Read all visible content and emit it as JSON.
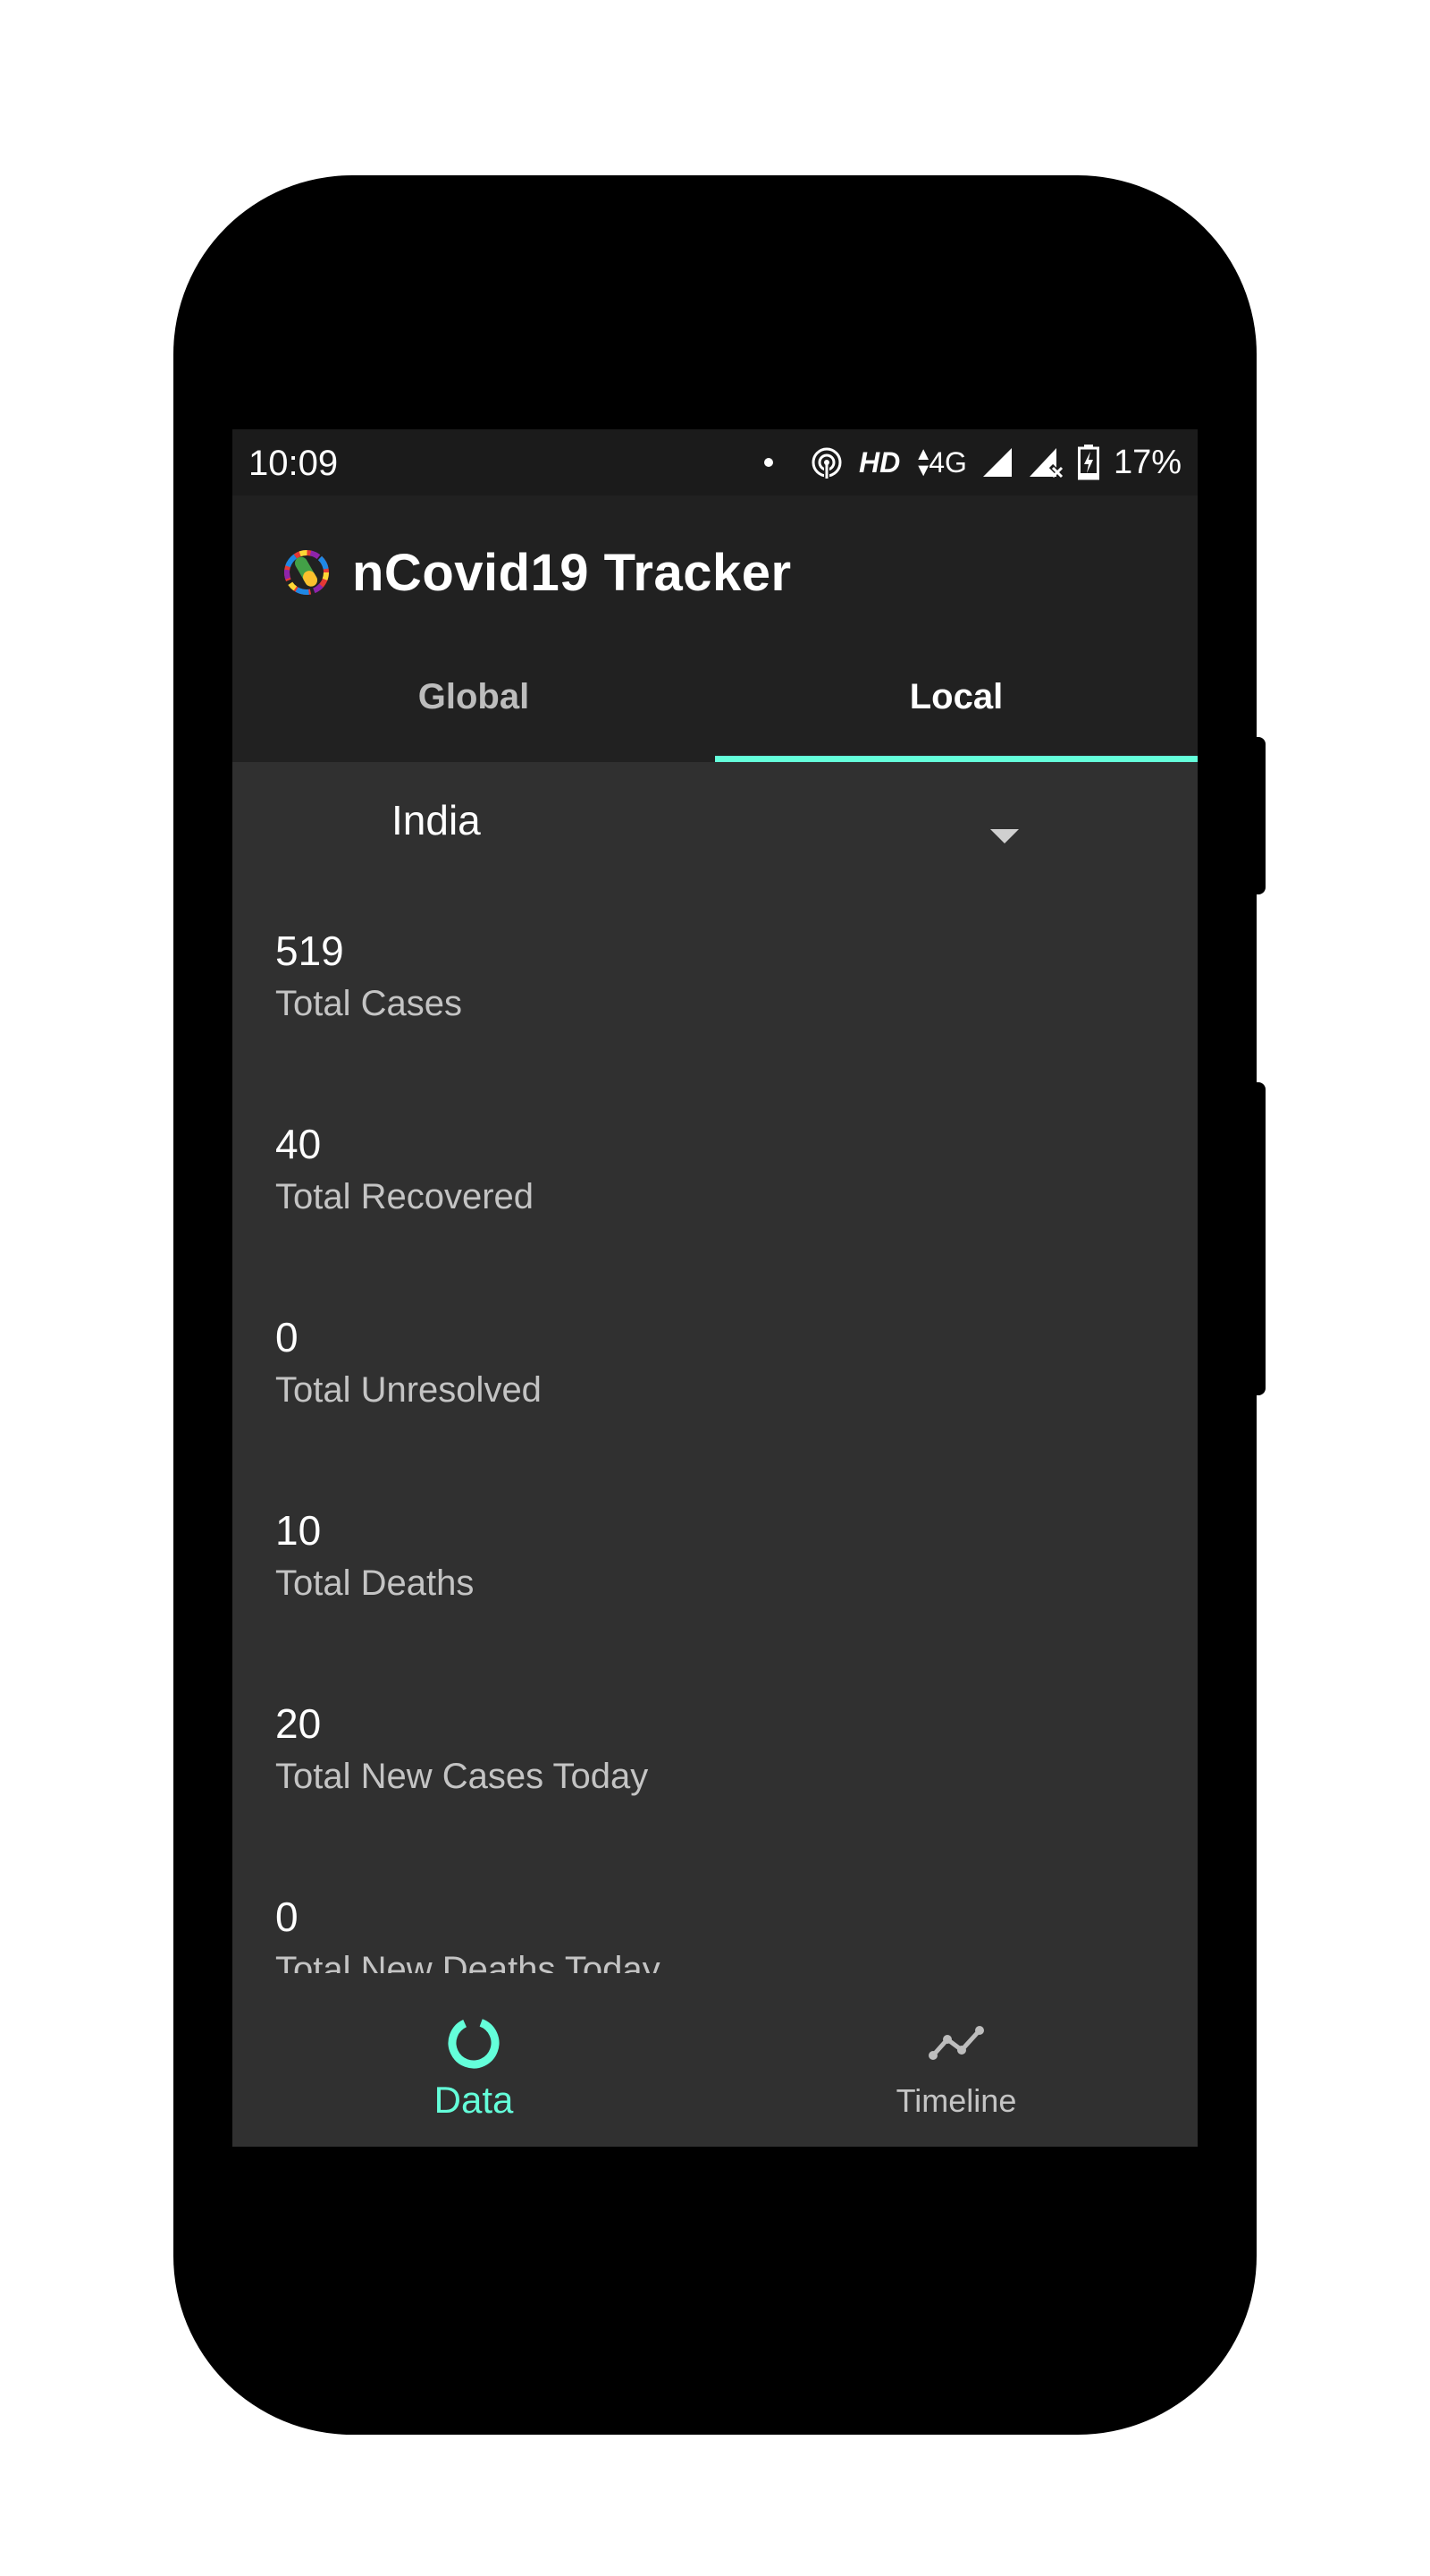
{
  "status_bar": {
    "time": "10:09",
    "network_hd": "HD",
    "network_type": "4G",
    "battery_percent": "17%",
    "icons": [
      "notification-dot-icon",
      "hotspot-icon",
      "data-arrows-icon",
      "signal-icon",
      "signal-no-service-icon",
      "battery-charging-icon"
    ]
  },
  "app_bar": {
    "title": "nCovid19 Tracker",
    "logo_icon": "virus-logo-icon"
  },
  "tabs": [
    {
      "label": "Global",
      "active": false
    },
    {
      "label": "Local",
      "active": true
    }
  ],
  "country_select": {
    "selected": "India"
  },
  "stats": [
    {
      "value": "519",
      "label": "Total Cases"
    },
    {
      "value": "40",
      "label": "Total Recovered"
    },
    {
      "value": "0",
      "label": "Total Unresolved"
    },
    {
      "value": "10",
      "label": "Total Deaths"
    },
    {
      "value": "20",
      "label": "Total New Cases Today"
    },
    {
      "value": "0",
      "label": "Total New Deaths Today"
    }
  ],
  "bottom_nav": [
    {
      "label": "Data",
      "icon": "donut-chart-icon",
      "active": true
    },
    {
      "label": "Timeline",
      "icon": "line-chart-icon",
      "active": false
    }
  ],
  "colors": {
    "accent": "#64ffda",
    "app_bar": "#212121",
    "background": "#303030",
    "status_bar": "#1b1b1b"
  }
}
